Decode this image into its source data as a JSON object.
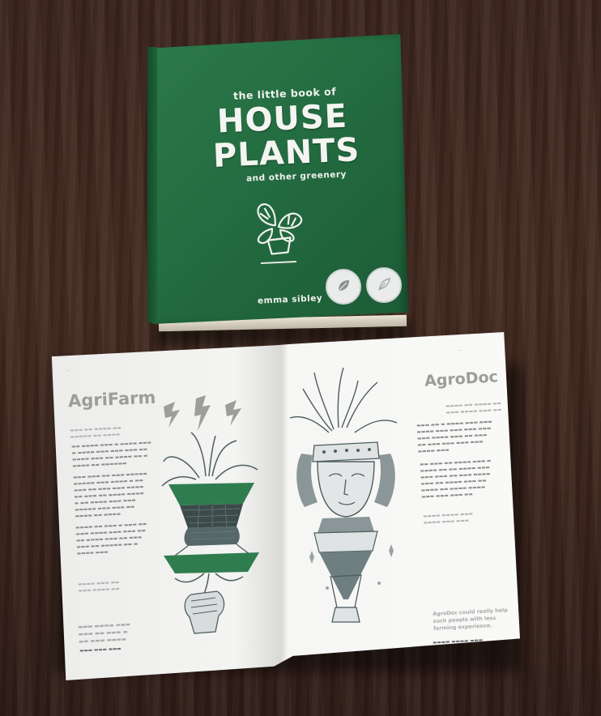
{
  "book": {
    "title_small": "the little book of",
    "title_line1": "HOUSE",
    "title_line2": "PLANTS",
    "subtitle": "and other greenery",
    "author": "emma sibley",
    "badges": [
      "leaf-icon",
      "feather-icon"
    ],
    "colors": {
      "cover": "#236b41",
      "text": "#f2f2ee"
    },
    "illustration": "monstera-pot-icon"
  },
  "brochure": {
    "left": {
      "heading": "AgriFarm",
      "illustration": "plant-hand-icon",
      "decoration": "lightning-bolt-icon"
    },
    "right": {
      "heading": "AgroDoc",
      "illustration": "goddess-bust-icon",
      "quote": "AgroDoc could really help such people with less farming experience."
    },
    "colors": {
      "paper": "#f4f4f2",
      "ink": "#4a5a5a",
      "accent": "#2d8050"
    }
  }
}
